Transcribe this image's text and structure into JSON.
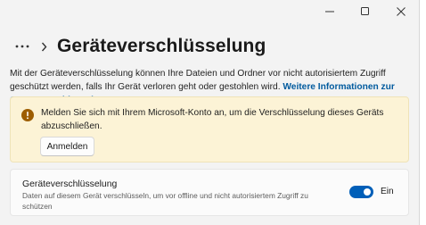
{
  "window": {
    "controls": [
      "minimize-icon",
      "maximize-icon",
      "close-icon"
    ]
  },
  "header": {
    "more_icon": "more-horizontal-icon",
    "chevron_icon": "chevron-right-icon",
    "title": "Geräteverschlüsselung"
  },
  "intro": {
    "text": "Mit der Geräteverschlüsselung können Ihre Dateien und Ordner vor nicht autorisiertem Zugriff geschützt werden, falls Ihr Gerät verloren geht oder gestohlen wird.",
    "link": "Weitere Informationen zur Geräteverschlüsselung"
  },
  "warning": {
    "icon": "warning-icon",
    "text": "Melden Sie sich mit Ihrem Microsoft-Konto an, um die Verschlüsselung dieses Geräts abzuschließen.",
    "button_label": "Anmelden"
  },
  "setting": {
    "title": "Geräteverschlüsselung",
    "description": "Daten auf diesem Gerät verschlüsseln, um vor offline und nicht autorisiertem Zugriff zu schützen",
    "toggle_state": "Ein",
    "toggle_on": true
  },
  "colors": {
    "accent": "#005fb8",
    "link": "#005a9e",
    "warning_bg": "#fcf3d6",
    "warning_icon": "#9d5d00"
  }
}
